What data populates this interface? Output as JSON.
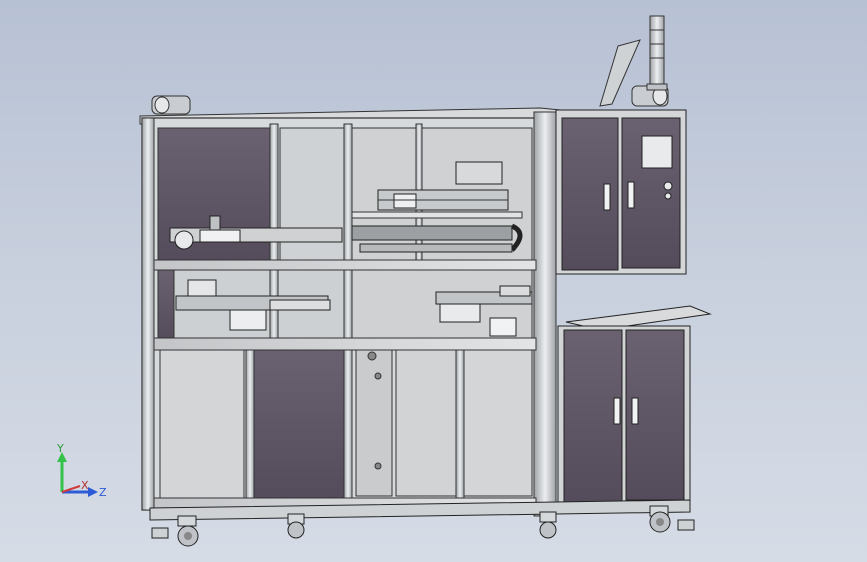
{
  "triad": {
    "y_label": "Y",
    "x_label": "X",
    "z_label": "Z",
    "colors": {
      "y": "#33c24a",
      "x": "#d03b3b",
      "z": "#2d5ad6"
    }
  },
  "scene": {
    "subject": "machine-frame-model",
    "colors": {
      "frame": "#d9dcdf",
      "frame_edge": "#3a3a3a",
      "panel_dark": "#5e5565",
      "panel_light": "#c9cbcd",
      "cabinet": "#5b5263",
      "background_top": "#b7c1d4",
      "background_bottom": "#d6dce6"
    },
    "icons": [
      "stack-light-icon",
      "hmi-screen-icon",
      "caster-wheel-icon",
      "door-handle-icon"
    ]
  }
}
